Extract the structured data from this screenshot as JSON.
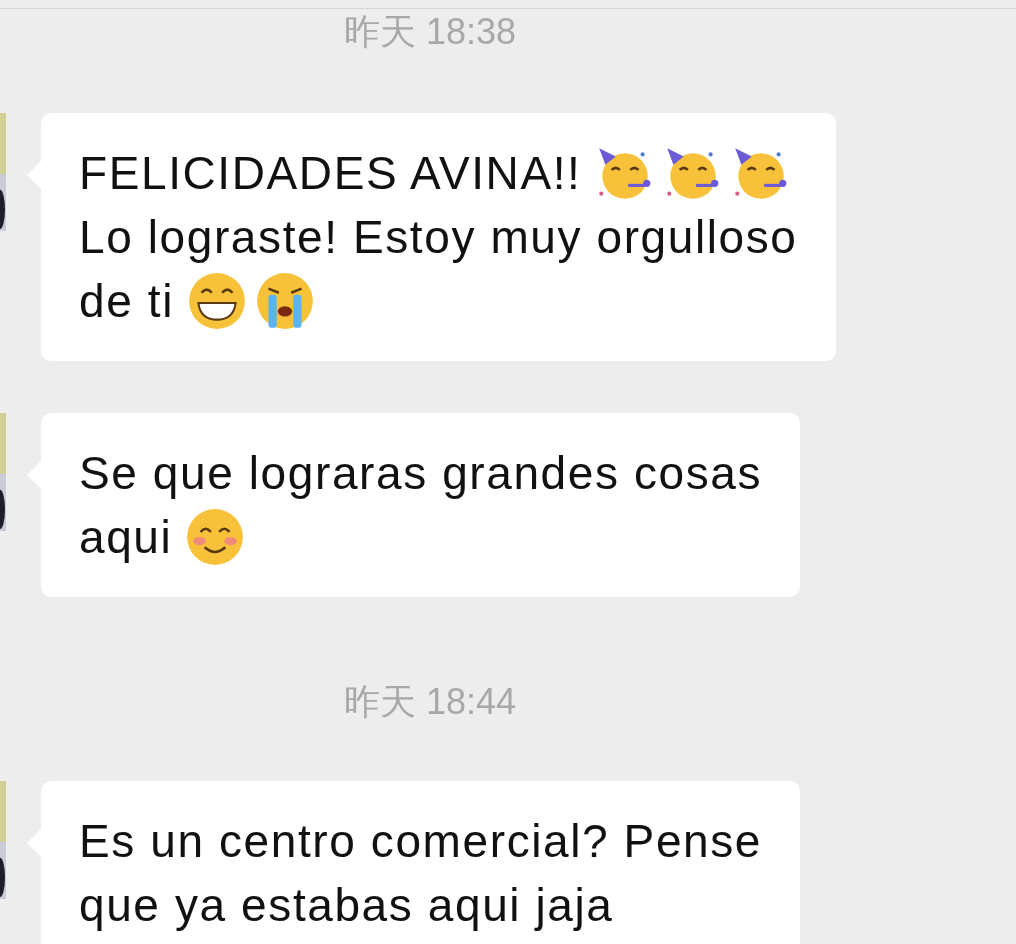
{
  "chat": [
    {
      "kind": "timestamp",
      "text": "昨天 18:38"
    },
    {
      "kind": "message",
      "lines": [
        [
          {
            "kind": "text",
            "text": "FELICIDADES AVINA!!"
          },
          {
            "kind": "party"
          },
          {
            "kind": "party"
          },
          {
            "kind": "party"
          }
        ],
        [
          {
            "kind": "text",
            "text": "Lo lograste! Estoy muy orgulloso"
          }
        ],
        [
          {
            "kind": "text",
            "text": "de ti"
          },
          {
            "kind": "grin"
          },
          {
            "kind": "cry"
          }
        ]
      ]
    },
    {
      "kind": "message",
      "lines": [
        [
          {
            "kind": "text",
            "text": "Se que lograras grandes cosas"
          }
        ],
        [
          {
            "kind": "text",
            "text": "aqui"
          },
          {
            "kind": "smile"
          }
        ]
      ]
    },
    {
      "kind": "timestamp",
      "text": "昨天 18:44"
    },
    {
      "kind": "message",
      "lines": [
        [
          {
            "kind": "text",
            "text": "Es un centro comercial? Pense"
          }
        ],
        [
          {
            "kind": "text",
            "text": "que ya estabas aqui jaja"
          }
        ]
      ]
    }
  ]
}
